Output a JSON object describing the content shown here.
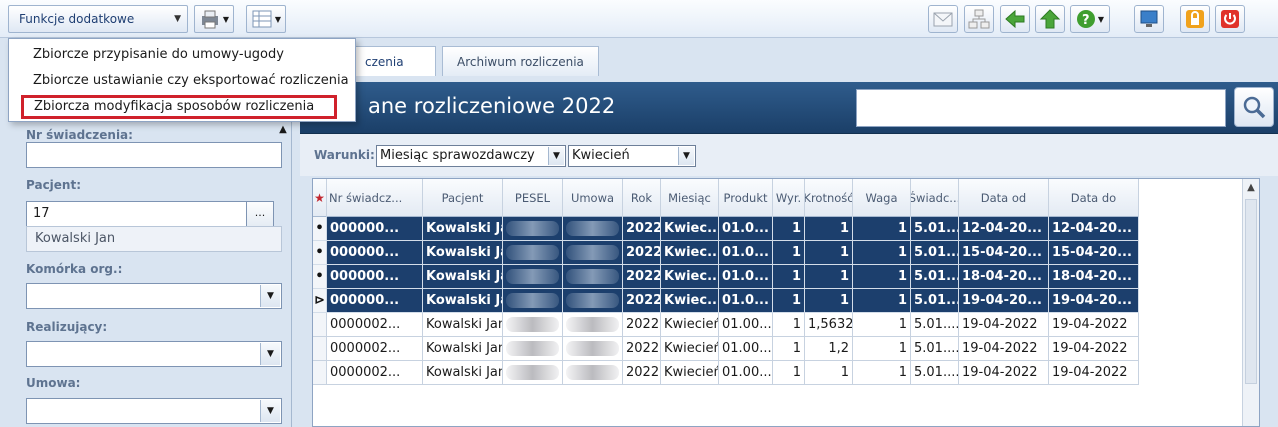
{
  "toolbar": {
    "func_button_label": "Funkcje dodatkowe"
  },
  "menu": {
    "items": [
      "Zbiorcze przypisanie do umowy-ugody",
      "Zbiorcze ustawianie czy eksportować rozliczenia",
      "Zbiorcza modyfikacja sposobów rozliczenia"
    ]
  },
  "tabs": {
    "active_partial": "czenia",
    "archive": "Archiwum rozliczenia"
  },
  "header": {
    "title": "ane rozliczeniowe 2022"
  },
  "left_panel": {
    "nr_label": "Nr świadczenia:",
    "pacjent_label": "Pacjent:",
    "pacjent_value": "17",
    "pacjent_name": "Kowalski Jan",
    "ellipsis": "...",
    "komorka_label": "Komórka org.:",
    "realizujacy_label": "Realizujący:",
    "umowa_label": "Umowa:"
  },
  "conditions": {
    "label": "Warunki:",
    "field": "Miesiąc sprawozdawczy",
    "value": "Kwiecień"
  },
  "grid": {
    "columns": [
      "Nr świadcz...",
      "Pacjent",
      "PESEL",
      "Umowa",
      "Rok",
      "Miesiąc",
      "Produkt",
      "Wyr.",
      "Krotność",
      "Waga",
      "Świadc...",
      "Data od",
      "Data do"
    ],
    "rows": [
      {
        "selected": true,
        "indicator": "•",
        "nr": "000000...",
        "pacjent": "Kowalski Jan",
        "rok": "2022",
        "miesiac": "Kwiec...",
        "produkt": "01.0...",
        "wyr": "1",
        "krotnosc": "1",
        "waga": "1",
        "swiadc": "5.01....",
        "data_od": "12-04-20...",
        "data_do": "12-04-20..."
      },
      {
        "selected": true,
        "indicator": "•",
        "nr": "000000...",
        "pacjent": "Kowalski Jan",
        "rok": "2022",
        "miesiac": "Kwiec...",
        "produkt": "01.0...",
        "wyr": "1",
        "krotnosc": "1",
        "waga": "1",
        "swiadc": "5.01....",
        "data_od": "15-04-20...",
        "data_do": "15-04-20..."
      },
      {
        "selected": true,
        "indicator": "•",
        "nr": "000000...",
        "pacjent": "Kowalski Jan",
        "rok": "2022",
        "miesiac": "Kwiec...",
        "produkt": "01.0...",
        "wyr": "1",
        "krotnosc": "1",
        "waga": "1",
        "swiadc": "5.01....",
        "data_od": "18-04-20...",
        "data_do": "18-04-20..."
      },
      {
        "selected": true,
        "indicator": "⊳",
        "nr": "000000...",
        "pacjent": "Kowalski Jan",
        "rok": "2022",
        "miesiac": "Kwiec...",
        "produkt": "01.0...",
        "wyr": "1",
        "krotnosc": "1",
        "waga": "1",
        "swiadc": "5.01....",
        "data_od": "19-04-20...",
        "data_do": "19-04-20..."
      },
      {
        "selected": false,
        "indicator": "",
        "nr": "0000002...",
        "pacjent": "Kowalski Jan",
        "rok": "2022",
        "miesiac": "Kwiecień",
        "produkt": "01.00...",
        "wyr": "1",
        "krotnosc": "1,5632",
        "waga": "1",
        "swiadc": "5.01....",
        "data_od": "19-04-2022",
        "data_do": "19-04-2022"
      },
      {
        "selected": false,
        "indicator": "",
        "nr": "0000002...",
        "pacjent": "Kowalski Jan",
        "rok": "2022",
        "miesiac": "Kwiecień",
        "produkt": "01.00...",
        "wyr": "1",
        "krotnosc": "1,2",
        "waga": "1",
        "swiadc": "5.01....",
        "data_od": "19-04-2022",
        "data_do": "19-04-2022"
      },
      {
        "selected": false,
        "indicator": "",
        "nr": "0000002...",
        "pacjent": "Kowalski Jan",
        "rok": "2022",
        "miesiac": "Kwiecień",
        "produkt": "01.00...",
        "wyr": "1",
        "krotnosc": "1",
        "waga": "1",
        "swiadc": "5.01....",
        "data_od": "19-04-2022",
        "data_do": "19-04-2022"
      }
    ]
  },
  "colors": {
    "selected_row": "#1c3f6d",
    "header_band": "#2f5c8c",
    "highlight_border": "#d0212b"
  }
}
